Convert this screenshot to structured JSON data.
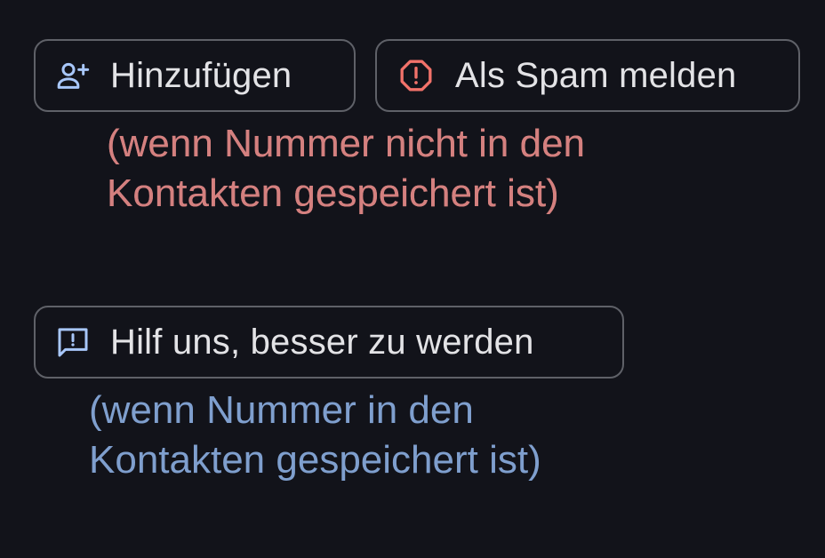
{
  "buttons": {
    "add": {
      "label": "Hinzufügen",
      "icon": "person-add-icon"
    },
    "spam": {
      "label": "Als Spam melden",
      "icon": "alert-octagon-icon"
    },
    "help": {
      "label": "Hilf uns, besser zu werden",
      "icon": "feedback-icon"
    }
  },
  "notes": {
    "not_in_contacts": {
      "line1": "(wenn Nummer nicht in den",
      "line2": "Kontakten gespeichert ist)"
    },
    "in_contacts": {
      "line1": "(wenn Nummer in den",
      "line2": "Kontakten gespeichert ist)"
    }
  },
  "colors": {
    "background": "#12131a",
    "chip_border": "#5f6168",
    "chip_text": "#e3e3e6",
    "add_icon": "#a8c7fa",
    "spam_icon": "#f2726a",
    "help_icon": "#a8c7fa",
    "note_red": "#d4807f",
    "note_blue": "#7f9fce"
  }
}
